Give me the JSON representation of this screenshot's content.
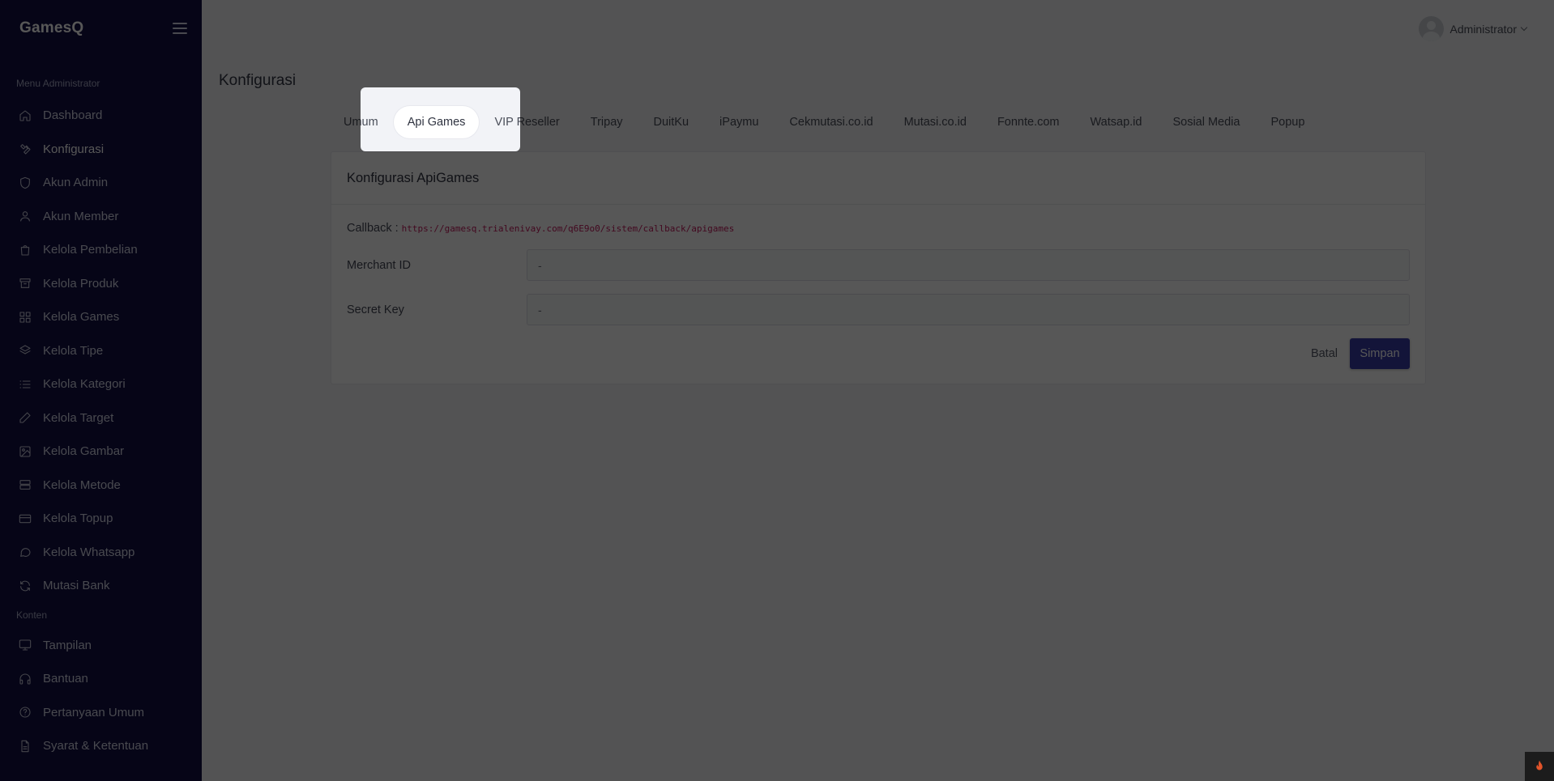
{
  "brand": "GamesQ",
  "sidebar": {
    "section_admin": "Menu Administrator",
    "items": [
      {
        "label": "Dashboard",
        "icon": "home-icon"
      },
      {
        "label": "Konfigurasi",
        "icon": "wrench-icon"
      },
      {
        "label": "Akun Admin",
        "icon": "shield-icon"
      },
      {
        "label": "Akun Member",
        "icon": "user-icon"
      },
      {
        "label": "Kelola Pembelian",
        "icon": "shopping-bag-icon"
      },
      {
        "label": "Kelola Produk",
        "icon": "archive-icon"
      },
      {
        "label": "Kelola Games",
        "icon": "grid-icon"
      },
      {
        "label": "Kelola Tipe",
        "icon": "layers-icon"
      },
      {
        "label": "Kelola Kategori",
        "icon": "list-icon"
      },
      {
        "label": "Kelola Target",
        "icon": "pen-icon"
      },
      {
        "label": "Kelola Gambar",
        "icon": "image-icon"
      },
      {
        "label": "Kelola Metode",
        "icon": "server-icon"
      },
      {
        "label": "Kelola Topup",
        "icon": "credit-card-icon"
      },
      {
        "label": "Kelola Whatsapp",
        "icon": "message-circle-icon"
      },
      {
        "label": "Mutasi Bank",
        "icon": "refresh-icon"
      }
    ],
    "section_konten": "Konten",
    "konten_items": [
      {
        "label": "Tampilan",
        "icon": "monitor-icon"
      },
      {
        "label": "Bantuan",
        "icon": "headphones-icon"
      },
      {
        "label": "Pertanyaan Umum",
        "icon": "help-circle-icon"
      },
      {
        "label": "Syarat & Ketentuan",
        "icon": "file-text-icon"
      }
    ]
  },
  "header": {
    "user_name": "Administrator"
  },
  "page": {
    "title": "Konfigurasi"
  },
  "tabs": [
    "Umum",
    "Api Games",
    "VIP Reseller",
    "Tripay",
    "DuitKu",
    "iPaymu",
    "Cekmutasi.co.id",
    "Mutasi.co.id",
    "Fonnte.com",
    "Watsap.id",
    "Sosial Media",
    "Popup"
  ],
  "active_tab": "Api Games",
  "card": {
    "title": "Konfigurasi ApiGames",
    "callback_label": "Callback :",
    "callback_url": "https://gamesq.trialenivay.com/q6E9o0/sistem/callback/apigames",
    "merchant_label": "Merchant ID",
    "merchant_value": "-",
    "secret_label": "Secret Key",
    "secret_value": "-",
    "cancel_label": "Batal",
    "save_label": "Simpan"
  },
  "colors": {
    "sidebar_bg": "#121044",
    "primary": "#3a3ca8",
    "callback_code": "#c2185b"
  }
}
